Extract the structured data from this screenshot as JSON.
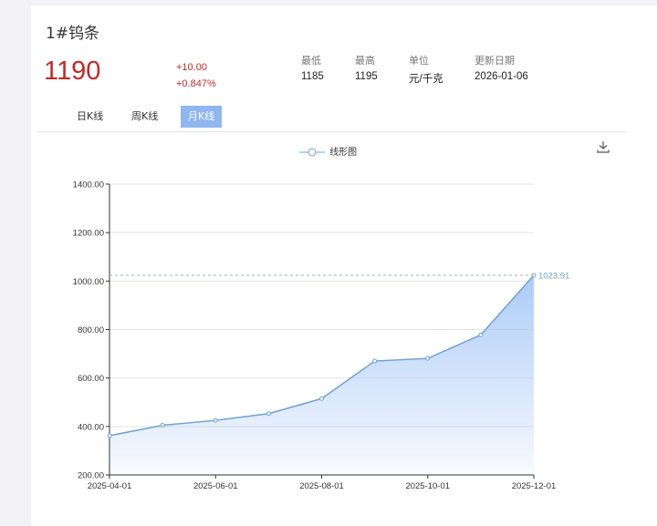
{
  "product": {
    "title": "1#钨条"
  },
  "quote": {
    "price": "1190",
    "change": "+10.00",
    "change_pct": "+0.847%",
    "stats": [
      {
        "label": "最低",
        "value": "1185"
      },
      {
        "label": "最高",
        "value": "1195"
      },
      {
        "label": "单位",
        "value": "元/千克"
      },
      {
        "label": "更新日期",
        "value": "2026-01-06"
      }
    ]
  },
  "tabs": [
    "日K线",
    "周K线",
    "月K线"
  ],
  "active_tab": "月K线",
  "legend_label": "线形图",
  "download_icon": "download-icon",
  "colors": {
    "price": "#c62828",
    "line": "#6fa1d4",
    "area_top": "#a9c9f7",
    "tab_active": "#8fb6ef"
  },
  "chart_data": {
    "type": "area",
    "x": [
      "2025-04-01",
      "2025-05-01",
      "2025-06-01",
      "2025-07-01",
      "2025-08-01",
      "2025-09-01",
      "2025-10-01",
      "2025-11-01",
      "2025-12-01"
    ],
    "xticks": [
      "2025-04-01",
      "2025-06-01",
      "2025-08-01",
      "2025-10-01",
      "2025-12-01"
    ],
    "yticks": [
      "200.00",
      "400.00",
      "600.00",
      "800.00",
      "1000.00",
      "1200.00",
      "1400.00"
    ],
    "series": [
      {
        "values": [
          362,
          405,
          425,
          453,
          515,
          670,
          681,
          778,
          1023.91
        ]
      }
    ],
    "ylim": [
      200,
      1400
    ],
    "last_label": "1023.91",
    "markline": 1023.91,
    "grid": true
  }
}
